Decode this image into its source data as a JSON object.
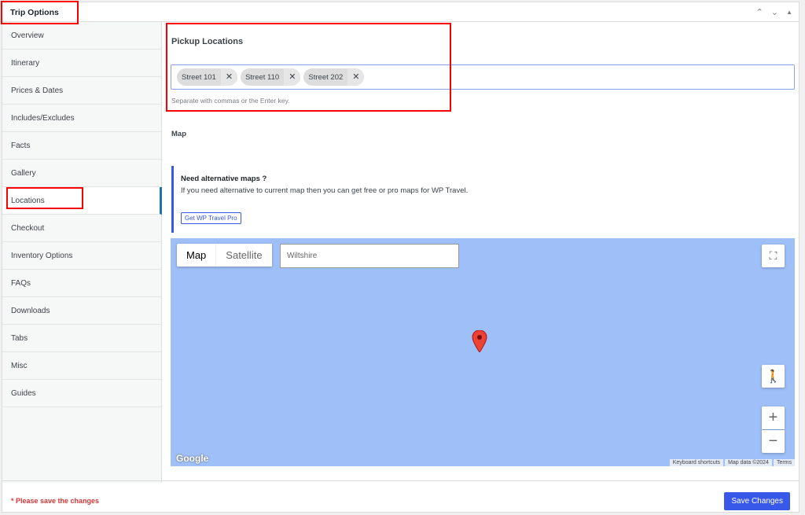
{
  "header": {
    "title": "Trip Options",
    "controls": [
      "chevron-up",
      "chevron-down",
      "triangle-up"
    ]
  },
  "sidebar": {
    "items": [
      {
        "label": "Overview"
      },
      {
        "label": "Itinerary"
      },
      {
        "label": "Prices & Dates"
      },
      {
        "label": "Includes/Excludes"
      },
      {
        "label": "Facts"
      },
      {
        "label": "Gallery"
      },
      {
        "label": "Locations",
        "active": true
      },
      {
        "label": "Checkout"
      },
      {
        "label": "Inventory Options"
      },
      {
        "label": "FAQs"
      },
      {
        "label": "Downloads"
      },
      {
        "label": "Tabs"
      },
      {
        "label": "Misc"
      },
      {
        "label": "Guides"
      }
    ]
  },
  "pickup": {
    "title": "Pickup Locations",
    "tags": [
      "Street 101",
      "Street 110",
      "Street 202"
    ],
    "remove_glyph": "✕",
    "hint": "Separate with commas or the Enter key."
  },
  "map_section": {
    "label": "Map",
    "notice_title": "Need alternative maps ?",
    "notice_desc": "If you need alternative to current map then you can get free or pro maps for WP Travel.",
    "notice_button": "Get WP Travel Pro"
  },
  "map": {
    "tab_map": "Map",
    "tab_satellite": "Satellite",
    "search_value": "Wiltshire",
    "google": "Google",
    "keyboard": "Keyboard shortcuts",
    "mapdata": "Map data ©2024",
    "terms": "Terms",
    "zoom_in": "+",
    "zoom_out": "−"
  },
  "footer": {
    "warning": "* Please save the changes",
    "save": "Save Changes"
  },
  "colors": {
    "accent": "#3858e9",
    "warning": "#d63638",
    "map_bg": "#9ebff7"
  }
}
